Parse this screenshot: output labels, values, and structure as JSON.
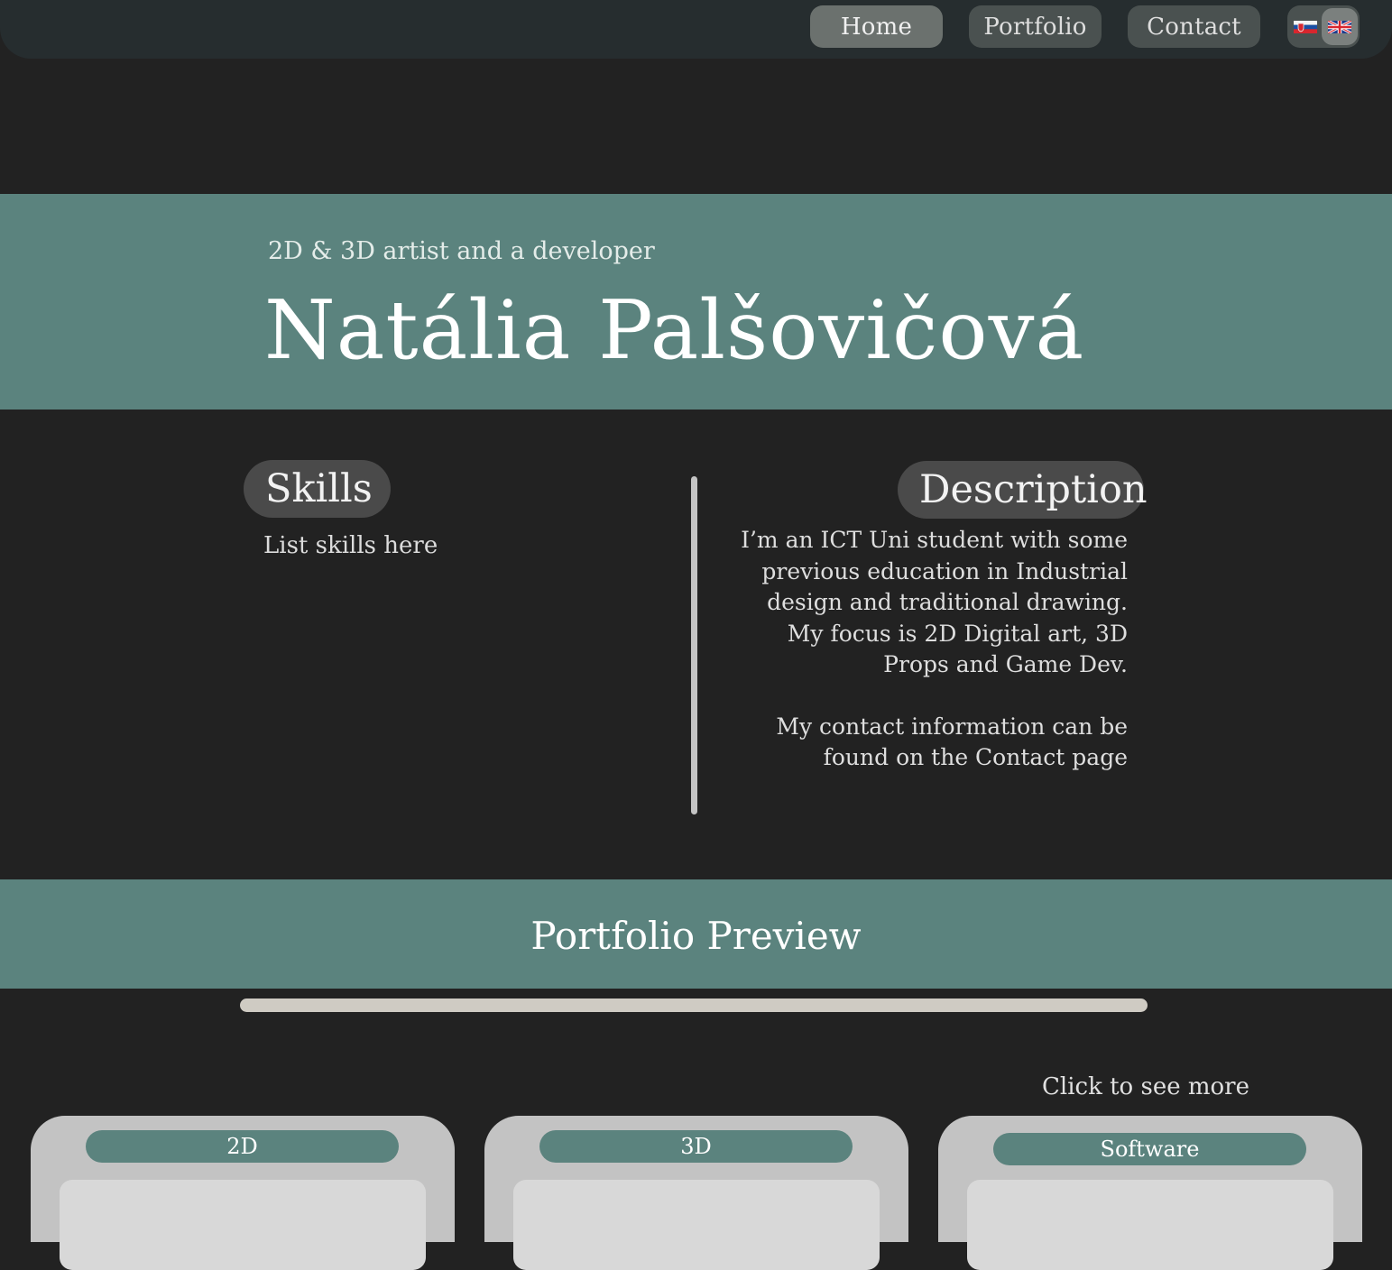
{
  "nav": {
    "items": [
      {
        "label": "Home",
        "active": true
      },
      {
        "label": "Portfolio",
        "active": false
      },
      {
        "label": "Contact",
        "active": false
      }
    ],
    "languages": [
      {
        "code": "sk",
        "icon": "slovak-flag-icon",
        "selected": false
      },
      {
        "code": "en",
        "icon": "uk-flag-icon",
        "selected": true
      }
    ]
  },
  "hero": {
    "subtitle": "2D & 3D artist and a developer",
    "name": "Natália Palšovičová"
  },
  "skills": {
    "title": "Skills",
    "text": "List skills here"
  },
  "description": {
    "title": "Description",
    "paragraph1": "I’m an ICT Uni student with some previous education in Industrial design and traditional drawing. My focus is 2D Digital art, 3D Props and Game Dev.",
    "paragraph2": "My contact information can be found on the Contact page"
  },
  "portfolio_preview": {
    "title": "Portfolio Preview",
    "hint": "Click to see more",
    "cards": [
      {
        "label": "2D"
      },
      {
        "label": "3D"
      },
      {
        "label": "Software"
      }
    ]
  },
  "colors": {
    "background": "#222222",
    "navbar": "#262d2f",
    "accent_teal": "#5b837e",
    "card": "#c3c3c3"
  }
}
